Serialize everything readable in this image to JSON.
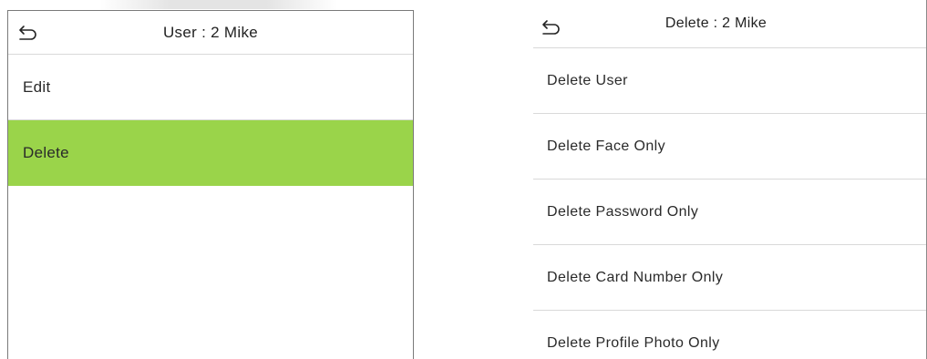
{
  "left_screen": {
    "title": "User : 2 Mike",
    "back_icon": "back-arrow-icon",
    "items": [
      {
        "label": "Edit",
        "selected": false
      },
      {
        "label": "Delete",
        "selected": true
      }
    ],
    "selected_color": "#9ad44a"
  },
  "right_screen": {
    "title": "Delete : 2 Mike",
    "back_icon": "back-arrow-icon",
    "items": [
      {
        "label": "Delete User"
      },
      {
        "label": "Delete Face Only"
      },
      {
        "label": "Delete Password Only"
      },
      {
        "label": "Delete Card Number Only"
      },
      {
        "label": "Delete Profile Photo Only"
      }
    ]
  }
}
